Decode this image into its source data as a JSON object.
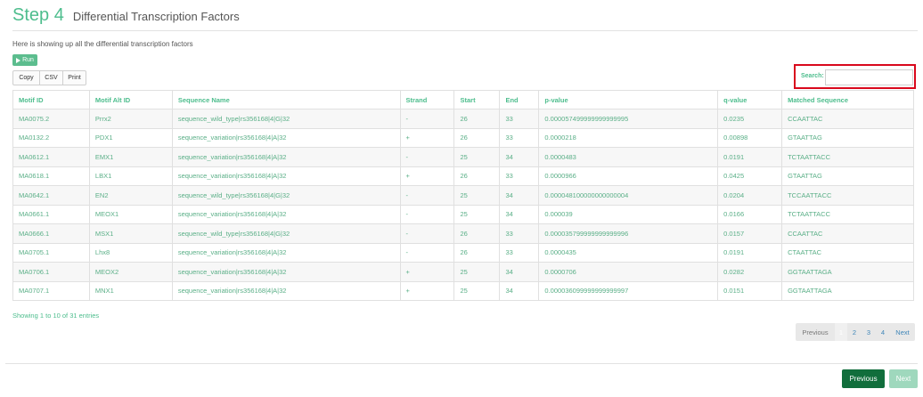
{
  "header": {
    "step": "Step 4",
    "subtitle": "Differential Transcription Factors"
  },
  "description": "Here is showing up all the differential transcription factors",
  "run_button": "Run",
  "export_buttons": {
    "copy": "Copy",
    "csv": "CSV",
    "print": "Print"
  },
  "search": {
    "label": "Search:",
    "value": ""
  },
  "table": {
    "columns": [
      "Motif ID",
      "Motif Alt ID",
      "Sequence Name",
      "Strand",
      "Start",
      "End",
      "p-value",
      "q-value",
      "Matched Sequence"
    ],
    "rows": [
      [
        "MA0075.2",
        "Prrx2",
        "sequence_wild_type|rs356168|4|G|32",
        "-",
        "26",
        "33",
        "0.000057499999999999995",
        "0.0235",
        "CCAATTAC"
      ],
      [
        "MA0132.2",
        "PDX1",
        "sequence_variation|rs356168|4|A|32",
        "+",
        "26",
        "33",
        "0.0000218",
        "0.00898",
        "GTAATTAG"
      ],
      [
        "MA0612.1",
        "EMX1",
        "sequence_variation|rs356168|4|A|32",
        "-",
        "25",
        "34",
        "0.0000483",
        "0.0191",
        "TCTAATTACC"
      ],
      [
        "MA0618.1",
        "LBX1",
        "sequence_variation|rs356168|4|A|32",
        "+",
        "26",
        "33",
        "0.0000966",
        "0.0425",
        "GTAATTAG"
      ],
      [
        "MA0642.1",
        "EN2",
        "sequence_wild_type|rs356168|4|G|32",
        "-",
        "25",
        "34",
        "0.000048100000000000004",
        "0.0204",
        "TCCAATTACC"
      ],
      [
        "MA0661.1",
        "MEOX1",
        "sequence_variation|rs356168|4|A|32",
        "-",
        "25",
        "34",
        "0.000039",
        "0.0166",
        "TCTAATTACC"
      ],
      [
        "MA0666.1",
        "MSX1",
        "sequence_wild_type|rs356168|4|G|32",
        "-",
        "26",
        "33",
        "0.000035799999999999996",
        "0.0157",
        "CCAATTAC"
      ],
      [
        "MA0705.1",
        "Lhx8",
        "sequence_variation|rs356168|4|A|32",
        "-",
        "26",
        "33",
        "0.0000435",
        "0.0191",
        "CTAATTAC"
      ],
      [
        "MA0706.1",
        "MEOX2",
        "sequence_variation|rs356168|4|A|32",
        "+",
        "25",
        "34",
        "0.0000706",
        "0.0282",
        "GGTAATTAGA"
      ],
      [
        "MA0707.1",
        "MNX1",
        "sequence_variation|rs356168|4|A|32",
        "+",
        "25",
        "34",
        "0.000036099999999999997",
        "0.0151",
        "GGTAATTAGA"
      ]
    ]
  },
  "entries_info": "Showing 1 to 10 of 31 entries",
  "pagination": {
    "previous": "Previous",
    "pages": [
      "1",
      "2",
      "3",
      "4"
    ],
    "next": "Next"
  },
  "footer": {
    "previous": "Previous",
    "next": "Next"
  },
  "colors": {
    "accent": "#4dbd8d",
    "dark_green": "#116e3c",
    "highlight": "#d9081c"
  }
}
